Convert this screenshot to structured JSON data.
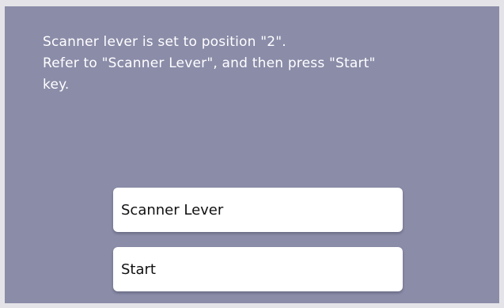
{
  "message": {
    "lines": [
      "Scanner lever is set to position \"2\".",
      "Refer to \"Scanner Lever\", and then press \"Start\"",
      "key."
    ]
  },
  "buttons": {
    "scanner_lever": "Scanner Lever",
    "start": "Start"
  },
  "colors": {
    "panel_background": "#8a8ca8",
    "message_text": "#ffffff",
    "button_background": "#ffffff",
    "button_text": "#111111"
  }
}
